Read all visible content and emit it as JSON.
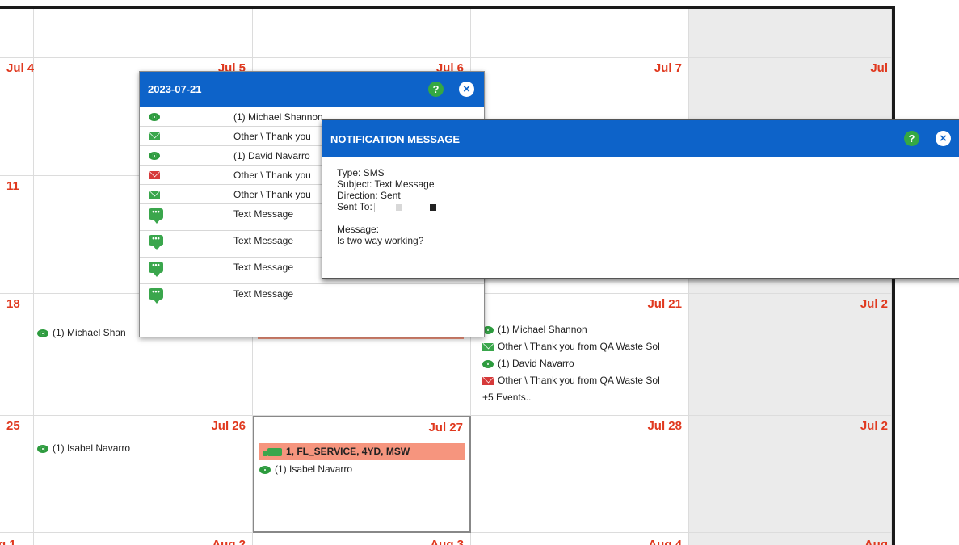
{
  "calendar": {
    "rows": [
      {
        "cells": [
          {
            "day": ""
          },
          {
            "day": ""
          },
          {
            "day": ""
          },
          {
            "day": ""
          },
          {
            "day": ""
          }
        ]
      },
      {
        "cells": [
          {
            "day": "Jul 4"
          },
          {
            "day": "Jul 5"
          },
          {
            "day": "Jul 6"
          },
          {
            "day": "Jul 7"
          },
          {
            "day": "Jul"
          }
        ]
      },
      {
        "cells": [
          {
            "day": "11"
          },
          {
            "day": ""
          },
          {
            "day": ""
          },
          {
            "day": ""
          },
          {
            "day": ""
          }
        ]
      },
      {
        "cells": [
          {
            "day": "18"
          },
          {
            "day": ""
          },
          {
            "day": ""
          },
          {
            "day": "Jul 21"
          },
          {
            "day": "Jul 2"
          }
        ]
      },
      {
        "cells": [
          {
            "day": "25"
          },
          {
            "day": "Jul 26"
          },
          {
            "day": "Jul 27"
          },
          {
            "day": "Jul 28"
          },
          {
            "day": "Jul 2"
          }
        ]
      },
      {
        "cells": [
          {
            "day": "g 1"
          },
          {
            "day": "Aug 2"
          },
          {
            "day": "Aug 3"
          },
          {
            "day": "Aug 4"
          },
          {
            "day": "Aug"
          }
        ]
      }
    ],
    "events": {
      "r3c1": [
        {
          "icon": "eye-icon",
          "text": "(1) Michael Shan"
        }
      ],
      "r3c3": [
        {
          "icon": "eye-icon",
          "text": "(1) Michael Shannon"
        },
        {
          "icon": "envelope-icon",
          "text": "Other \\ Thank you from QA Waste Sol"
        },
        {
          "icon": "eye-icon",
          "text": "(1) David Navarro"
        },
        {
          "icon": "envelope-red-icon",
          "text": "Other \\ Thank you from QA Waste Sol"
        },
        {
          "icon": "",
          "text": "+5 Events.."
        }
      ],
      "r4c1": [
        {
          "icon": "eye-icon",
          "text": "(1) Isabel Navarro"
        }
      ],
      "r4c2_service": "1, FL_SERVICE, 4YD, MSW",
      "r4c2": [
        {
          "icon": "eye-icon",
          "text": "(1) Isabel Navarro"
        }
      ]
    }
  },
  "day_popup": {
    "title": "2023-07-21",
    "help_label": "?",
    "close_label": "×",
    "rows": [
      {
        "icon": "eye-icon",
        "text": "(1) Michael Shannon"
      },
      {
        "icon": "envelope-icon",
        "text": "Other \\ Thank you"
      },
      {
        "icon": "eye-icon",
        "text": "(1) David Navarro"
      },
      {
        "icon": "envelope-red-icon",
        "text": "Other \\ Thank you"
      },
      {
        "icon": "envelope-icon",
        "text": "Other \\ Thank you"
      },
      {
        "icon": "chat-icon",
        "text": "Text Message"
      },
      {
        "icon": "chat-icon",
        "text": "Text Message"
      },
      {
        "icon": "chat-icon",
        "text": "Text Message"
      },
      {
        "icon": "chat-icon",
        "text": "Text Message"
      }
    ]
  },
  "notification": {
    "title": "NOTIFICATION MESSAGE",
    "help_label": "?",
    "close_label": "×",
    "type": "Type: SMS",
    "subject": "Subject: Text Message",
    "direction": "Direction: Sent",
    "sent_to": "Sent To:",
    "message_label": "Message:",
    "message": "Is two way working?"
  },
  "colors": {
    "header_blue": "#0d63c9",
    "help_green": "#35a843",
    "date_red": "#e0391f",
    "service_salmon": "#f6957e",
    "weekend_gray": "#ebebeb"
  }
}
